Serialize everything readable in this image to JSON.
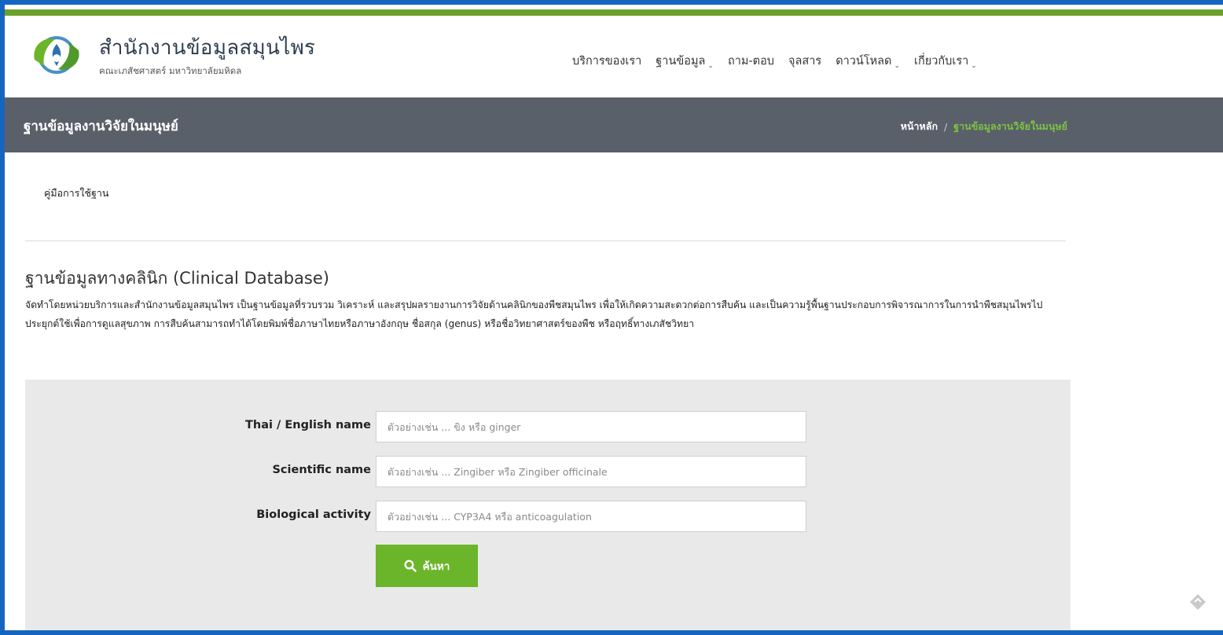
{
  "site": {
    "title": "สำนักงานข้อมูลสมุนไพร",
    "subtitle": "คณะเภสัชศาสตร์ มหาวิทยาลัยมหิดล"
  },
  "nav": {
    "items": [
      {
        "label": "บริการของเรา",
        "dropdown": false
      },
      {
        "label": "ฐานข้อมูล",
        "dropdown": true
      },
      {
        "label": "ถาม-ตอบ",
        "dropdown": false
      },
      {
        "label": "จุลสาร",
        "dropdown": false
      },
      {
        "label": "ดาวน์โหลด",
        "dropdown": true
      },
      {
        "label": "เกี่ยวกับเรา",
        "dropdown": true
      }
    ]
  },
  "page": {
    "title": "ฐานข้อมูลงานวิจัยในมนุษย์",
    "breadcrumb_home": "หน้าหลัก",
    "breadcrumb_sep": "/",
    "breadcrumb_current": "ฐานข้อมูลงานวิจัยในมนุษย์"
  },
  "content": {
    "manual_link": "คู่มือการใช้ฐาน",
    "section_title": "ฐานข้อมูลทางคลินิก (Clinical Database)",
    "description": "จัดทำโดยหน่วยบริการและสำนักงานข้อมูลสมุนไพร เป็นฐานข้อมูลที่รวบรวม วิเคราะห์ และสรุปผลรายงานการวิจัยด้านคลินิกของพืชสมุนไพร เพื่อให้เกิดความสะดวกต่อการสืบค้น และเป็นความรู้พื้นฐานประกอบการพิจารณาการในการนำพืชสมุนไพรไปประยุกต์ใช้เพื่อการดูแลสุขภาพ การสืบค้นสามารถทำได้โดยพิมพ์ชื่อภาษาไทยหรือภาษาอังกฤษ ชื่อสกุล (genus) หรือชื่อวิทยาศาสตร์ของพืช หรือฤทธิ์ทางเภสัชวิทยา"
  },
  "search": {
    "fields": [
      {
        "label": "Thai / English name",
        "placeholder": "ตัวอย่างเช่น ... ขิง หรือ ginger",
        "value": ""
      },
      {
        "label": "Scientific name",
        "placeholder": "ตัวอย่างเช่น ... Zingiber หรือ Zingiber officinale",
        "value": ""
      },
      {
        "label": "Biological activity",
        "placeholder": "ตัวอย่างเช่น ... CYP3A4 หรือ anticoagulation",
        "value": ""
      }
    ],
    "button_label": "ค้นหา",
    "button_icon": "search-icon"
  },
  "colors": {
    "accent_green": "#6bb52a",
    "title_bar": "#5a6069",
    "frame_blue": "#1565c0",
    "breadcrumb_active": "#7cc242"
  }
}
